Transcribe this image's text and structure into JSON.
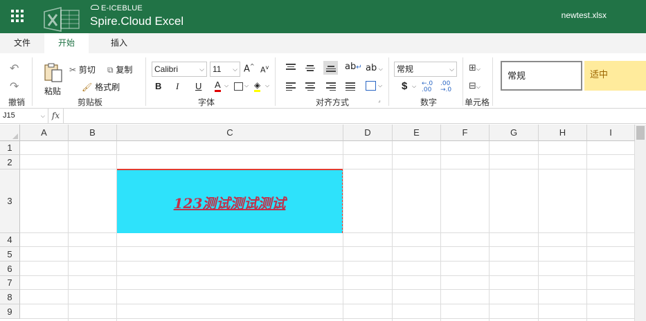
{
  "header": {
    "brand": "E-ICEBLUE",
    "app_name": "Spire.Cloud Excel",
    "filename": "newtest.xlsx"
  },
  "tabs": [
    {
      "label": "文件",
      "active": false
    },
    {
      "label": "开始",
      "active": true
    },
    {
      "label": "插入",
      "active": false
    }
  ],
  "ribbon": {
    "undo_group": {
      "label": "撤销"
    },
    "clipboard": {
      "label": "剪贴板",
      "paste": "粘贴",
      "cut": "剪切",
      "copy": "复制",
      "format_painter": "格式刷"
    },
    "font": {
      "label": "字体",
      "family": "Calibri",
      "size": "11",
      "bold": "B",
      "italic": "I",
      "underline": "U",
      "font_color_letter": "A",
      "font_color": "#e00000",
      "fill_color": "#ffff00"
    },
    "alignment": {
      "label": "对齐方式",
      "wrap": "ab",
      "orientation": "ab"
    },
    "number": {
      "label": "数字",
      "format": "常规",
      "currency": "$"
    },
    "cells": {
      "label": "单元格"
    },
    "styles": {
      "normal": "常规",
      "neutral": "适中",
      "neutral_bg": "#ffeb9c",
      "neutral_color": "#9c6500"
    }
  },
  "formula_bar": {
    "name_box": "J15",
    "fx": "fx",
    "value": ""
  },
  "sheet": {
    "columns": [
      "A",
      "B",
      "C",
      "D",
      "E",
      "F",
      "G",
      "H",
      "I"
    ],
    "rows": [
      "1",
      "2",
      "3",
      "4",
      "5",
      "6",
      "7",
      "8",
      "9"
    ],
    "cells": {
      "C3": {
        "value": "123测试测试测试",
        "fill": "#2ee2fb",
        "font_color": "#c0314b"
      }
    }
  }
}
